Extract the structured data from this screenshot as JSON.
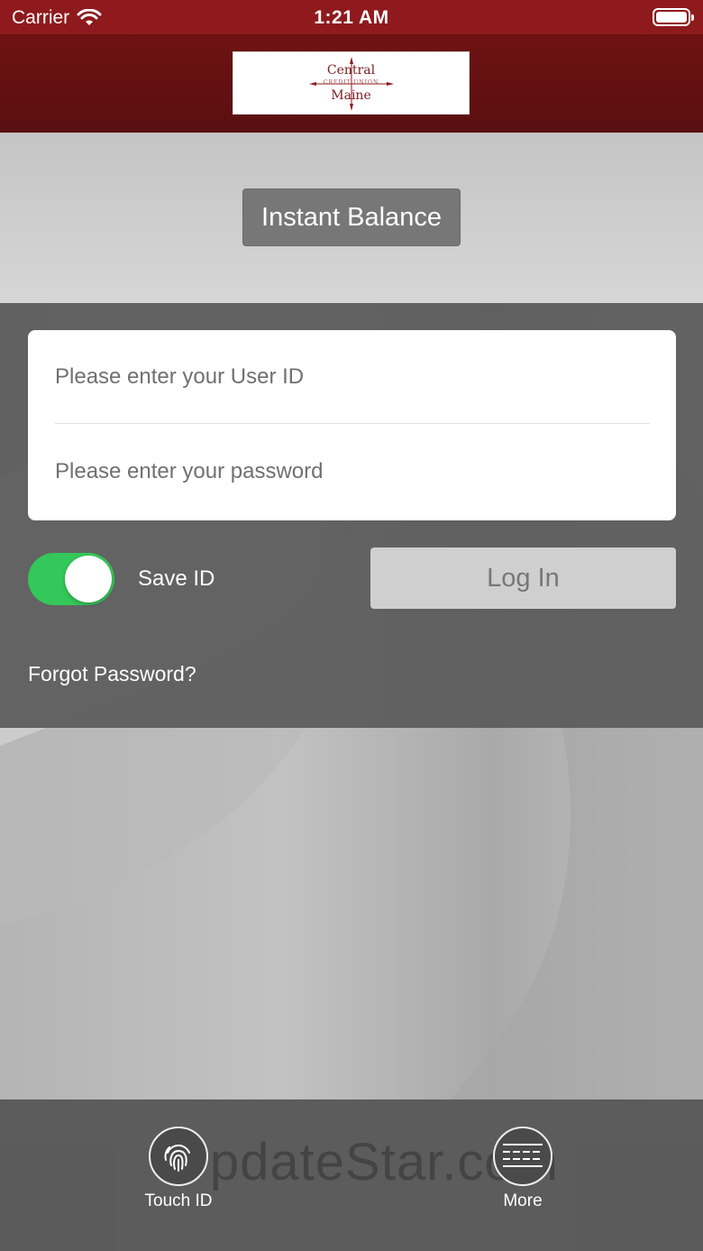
{
  "status_bar": {
    "carrier": "Carrier",
    "time": "1:21 AM"
  },
  "header": {
    "logo_line1": "Central",
    "logo_sub": "CREDIT UNION",
    "logo_line2": "Maine"
  },
  "balance": {
    "instant_balance_label": "Instant Balance"
  },
  "login": {
    "user_id_placeholder": "Please enter your User ID",
    "password_placeholder": "Please enter your password",
    "save_id_label": "Save ID",
    "save_id_on": true,
    "login_label": "Log In",
    "forgot_password_label": "Forgot Password?"
  },
  "tab_bar": {
    "touch_id_label": "Touch ID",
    "more_label": "More",
    "watermark": "UpdateStar.com"
  },
  "colors": {
    "brand": "#8e1a1d",
    "toggle_on": "#34c759"
  }
}
